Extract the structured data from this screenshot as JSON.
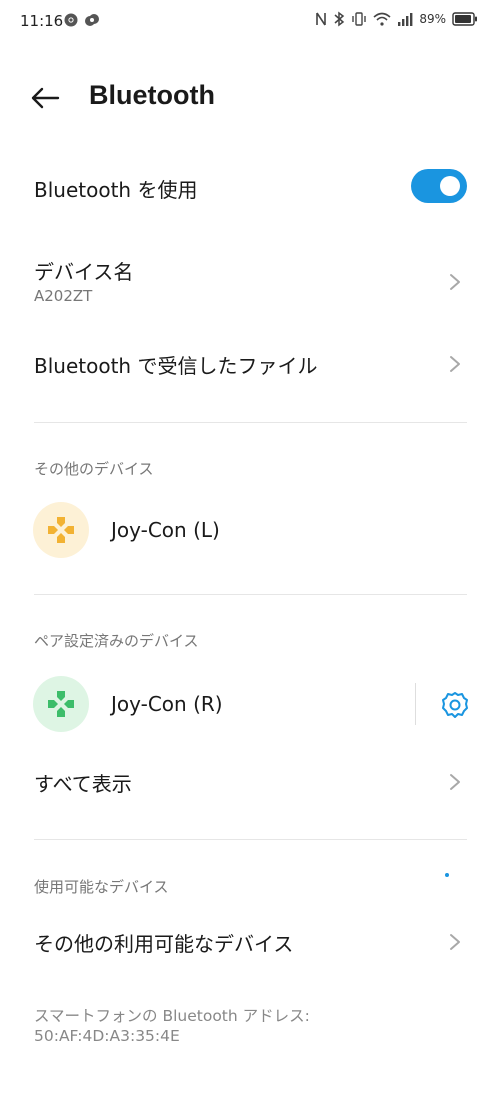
{
  "status_bar": {
    "time": "11:16",
    "battery": "89%"
  },
  "header": {
    "title": "Bluetooth"
  },
  "bluetooth_toggle": {
    "label": "Bluetooth を使用",
    "enabled": true,
    "color": "#1a95e0"
  },
  "device_name": {
    "label": "デバイス名",
    "value": "A202ZT"
  },
  "received_files": {
    "label": "Bluetooth で受信したファイル"
  },
  "other_devices": {
    "header": "その他のデバイス",
    "items": [
      {
        "name": "Joy-Con (L)",
        "icon": "gamepad-icon",
        "icon_color": "#f2b233",
        "icon_bg": "#fdf1d6"
      }
    ]
  },
  "paired_devices": {
    "header": "ペア設定済みのデバイス",
    "items": [
      {
        "name": "Joy-Con (R)",
        "icon": "gamepad-icon",
        "icon_color": "#3dbd6a",
        "icon_bg": "#def5e4"
      }
    ],
    "show_all_label": "すべて表示"
  },
  "available_devices": {
    "header": "使用可能なデバイス",
    "other_label": "その他の利用可能なデバイス"
  },
  "bt_address": {
    "label": "スマートフォンの Bluetooth アドレス:",
    "value": "50:AF:4D:A3:35:4E"
  }
}
